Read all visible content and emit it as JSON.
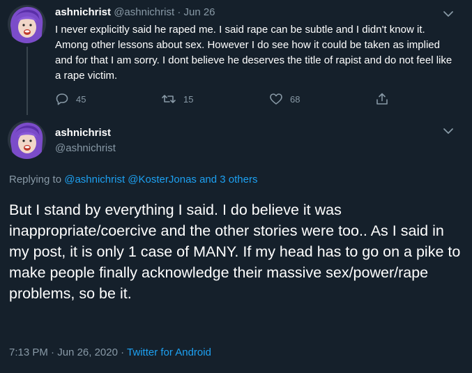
{
  "tweet1": {
    "name": "ashnichrist",
    "handle": "@ashnichrist",
    "separator": "·",
    "date": "Jun 26",
    "text": "I never explicitly said he raped me. I said rape can be subtle and I didn't know it. Among other lessons about sex. However I do see how it could be taken as implied and for that I am sorry. I dont believe he deserves the title of rapist and do not feel like a rape victim.",
    "reply_count": "45",
    "retweet_count": "15",
    "like_count": "68",
    "icons": [
      "reply-icon",
      "retweet-icon",
      "like-icon",
      "share-icon",
      "chevron-down-icon"
    ]
  },
  "tweet2": {
    "name": "ashnichrist",
    "handle": "@ashnichrist",
    "replying_prefix": "Replying to",
    "replying_mentions": "@ashnichrist @KosterJonas and 3 others",
    "text": "But I stand by everything I said. I do believe it was inappropriate/coercive and the other stories were too.. As I said in my post, it is only 1 case of MANY. If my head has to go on a pike to make people finally acknowledge their massive sex/power/rape problems, so be it.",
    "time": "7:13 PM",
    "separator": "·",
    "date": "Jun 26, 2020",
    "separator2": "·",
    "source": "Twitter for Android"
  },
  "colors": {
    "background": "#15202b",
    "text": "#ffffff",
    "muted": "#8899a6",
    "link": "#1da1f2",
    "thread_line": "#38444d"
  }
}
